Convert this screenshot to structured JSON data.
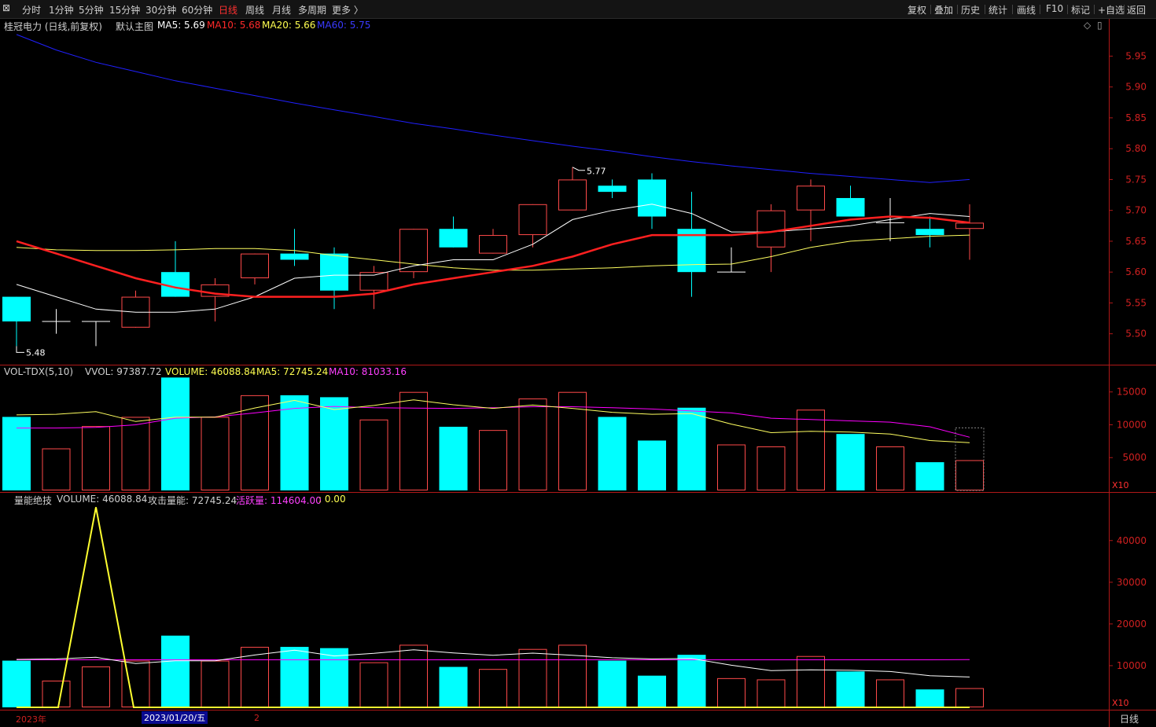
{
  "toolbar": {
    "left": [
      "分时",
      "1分钟",
      "5分钟",
      "15分钟",
      "30分钟",
      "60分钟",
      "日线",
      "周线",
      "月线",
      "多周期",
      "更多 〉"
    ],
    "active": "日线",
    "right": [
      "复权",
      "叠加",
      "历史",
      "统计",
      "画线",
      "F10",
      "标记",
      "+自选",
      "返回"
    ]
  },
  "main_legend": {
    "stock": "桂冠电力 (日线,前复权)",
    "template": "默认主图",
    "ma5": "MA5: 5.69",
    "ma10": "MA10: 5.68",
    "ma20": "MA20: 5.66",
    "ma60": "MA60: 5.75"
  },
  "vol_legend": {
    "name": "VOL-TDX(5,10)",
    "vvol": "VVOL: 97387.72",
    "volume": "VOLUME: 46088.84",
    "ma5": "MA5: 72745.24",
    "ma10": "MA10: 81033.16"
  },
  "energy_legend": {
    "name": "量能绝技",
    "volume": "VOLUME: 46088.84",
    "attack": "攻击量能: 72745.24",
    "active": "活跃量: 114604.00",
    "tail": ": 0.00"
  },
  "x10_label": "X10",
  "date_axis": {
    "year": "2023年",
    "cursor_date": "2023/01/20/五",
    "marker": "2"
  },
  "period_label": "日线",
  "colors": {
    "up": "#ff4a4a",
    "down": "#00ffff",
    "ma5": "#ffffff",
    "ma10": "#ff2020",
    "ma20": "#ffff60",
    "ma60": "#2020ff",
    "vol_ma10": "#ff00ff"
  },
  "chart_data": [
    {
      "type": "candlestick",
      "price_axis": {
        "ticks": [
          5.5,
          5.55,
          5.6,
          5.65,
          5.7,
          5.75,
          5.8,
          5.85,
          5.9,
          5.95
        ],
        "min": 5.455,
        "max": 5.99
      },
      "annotations": {
        "high": "5.77",
        "low": "5.48"
      },
      "candles": [
        {
          "o": 5.56,
          "h": 5.56,
          "l": 5.48,
          "c": 5.52
        },
        {
          "o": 5.52,
          "h": 5.54,
          "l": 5.5,
          "c": 5.52
        },
        {
          "o": 5.52,
          "h": 5.52,
          "l": 5.48,
          "c": 5.52
        },
        {
          "o": 5.51,
          "h": 5.57,
          "l": 5.51,
          "c": 5.56
        },
        {
          "o": 5.6,
          "h": 5.65,
          "l": 5.56,
          "c": 5.56
        },
        {
          "o": 5.56,
          "h": 5.59,
          "l": 5.52,
          "c": 5.58
        },
        {
          "o": 5.59,
          "h": 5.63,
          "l": 5.58,
          "c": 5.63
        },
        {
          "o": 5.63,
          "h": 5.67,
          "l": 5.61,
          "c": 5.62
        },
        {
          "o": 5.63,
          "h": 5.64,
          "l": 5.54,
          "c": 5.57
        },
        {
          "o": 5.57,
          "h": 5.61,
          "l": 5.54,
          "c": 5.6
        },
        {
          "o": 5.6,
          "h": 5.67,
          "l": 5.59,
          "c": 5.67
        },
        {
          "o": 5.67,
          "h": 5.69,
          "l": 5.64,
          "c": 5.64
        },
        {
          "o": 5.63,
          "h": 5.67,
          "l": 5.63,
          "c": 5.66
        },
        {
          "o": 5.66,
          "h": 5.71,
          "l": 5.64,
          "c": 5.71
        },
        {
          "o": 5.7,
          "h": 5.77,
          "l": 5.7,
          "c": 5.75
        },
        {
          "o": 5.74,
          "h": 5.75,
          "l": 5.72,
          "c": 5.73
        },
        {
          "o": 5.75,
          "h": 5.76,
          "l": 5.67,
          "c": 5.69
        },
        {
          "o": 5.67,
          "h": 5.73,
          "l": 5.56,
          "c": 5.6
        },
        {
          "o": 5.6,
          "h": 5.64,
          "l": 5.6,
          "c": 5.6
        },
        {
          "o": 5.64,
          "h": 5.71,
          "l": 5.6,
          "c": 5.7
        },
        {
          "o": 5.7,
          "h": 5.75,
          "l": 5.65,
          "c": 5.74
        },
        {
          "o": 5.72,
          "h": 5.74,
          "l": 5.69,
          "c": 5.69
        },
        {
          "o": 5.68,
          "h": 5.72,
          "l": 5.65,
          "c": 5.68
        },
        {
          "o": 5.67,
          "h": 5.69,
          "l": 5.64,
          "c": 5.66
        },
        {
          "o": 5.67,
          "h": 5.71,
          "l": 5.62,
          "c": 5.68
        }
      ],
      "ma5": [
        5.58,
        5.56,
        5.54,
        5.535,
        5.535,
        5.54,
        5.56,
        5.59,
        5.595,
        5.595,
        5.61,
        5.62,
        5.62,
        5.645,
        5.685,
        5.7,
        5.71,
        5.695,
        5.665,
        5.665,
        5.67,
        5.675,
        5.685,
        5.695,
        5.69
      ],
      "ma10": [
        5.65,
        5.63,
        5.61,
        5.59,
        5.575,
        5.565,
        5.56,
        5.56,
        5.56,
        5.565,
        5.58,
        5.59,
        5.6,
        5.61,
        5.625,
        5.645,
        5.66,
        5.66,
        5.66,
        5.665,
        5.675,
        5.685,
        5.69,
        5.688,
        5.68
      ],
      "ma20": [
        5.64,
        5.636,
        5.635,
        5.635,
        5.636,
        5.638,
        5.638,
        5.635,
        5.627,
        5.62,
        5.613,
        5.607,
        5.603,
        5.603,
        5.605,
        5.607,
        5.61,
        5.612,
        5.613,
        5.625,
        5.64,
        5.65,
        5.654,
        5.658,
        5.66
      ],
      "ma60": [
        5.985,
        5.96,
        5.94,
        5.925,
        5.91,
        5.898,
        5.886,
        5.874,
        5.863,
        5.852,
        5.841,
        5.832,
        5.822,
        5.813,
        5.804,
        5.796,
        5.787,
        5.779,
        5.772,
        5.766,
        5.76,
        5.755,
        5.75,
        5.745,
        5.75
      ]
    },
    {
      "type": "bar",
      "title": "VOL-TDX(5,10)",
      "axis": {
        "ticks": [
          5000,
          10000,
          15000
        ],
        "max": 17000,
        "multiplier": "X10"
      },
      "volume": [
        11200,
        6400,
        9800,
        11200,
        17200,
        11200,
        14500,
        14500,
        14200,
        10800,
        15000,
        9700,
        9200,
        14000,
        15000,
        11200,
        7600,
        12600,
        7000,
        6700,
        12300,
        8600,
        6700,
        4300,
        4610
      ],
      "ma5": [
        11500,
        11600,
        12000,
        10500,
        11160,
        11160,
        12560,
        13720,
        12320,
        12940,
        13800,
        13050,
        12500,
        13000,
        12500,
        11900,
        11600,
        11700,
        10100,
        8800,
        9000,
        8900,
        8600,
        7600,
        7270
      ],
      "ma10": [
        9500,
        9500,
        9600,
        10000,
        11000,
        11200,
        11800,
        12500,
        12800,
        12600,
        12550,
        12500,
        12600,
        12750,
        12750,
        12600,
        12400,
        12100,
        11800,
        11000,
        10800,
        10600,
        10400,
        9700,
        8100
      ]
    },
    {
      "type": "bar",
      "title": "量能绝技",
      "axis": {
        "ticks": [
          10000,
          20000,
          30000,
          40000
        ],
        "max": 49000,
        "multiplier": "X10"
      },
      "volume": [
        11200,
        6400,
        9800,
        11200,
        17200,
        11200,
        14500,
        14500,
        14200,
        10800,
        15000,
        9700,
        9200,
        14000,
        15000,
        11200,
        7600,
        12600,
        7000,
        6700,
        12300,
        8600,
        6700,
        4300,
        4610
      ],
      "attack": [
        11500,
        11600,
        12000,
        10500,
        11160,
        11160,
        12560,
        13720,
        12320,
        12940,
        13800,
        13050,
        12500,
        13000,
        12500,
        11900,
        11600,
        11700,
        10100,
        8800,
        9000,
        8900,
        8600,
        7600,
        7270
      ],
      "active_line": [
        11400,
        11400,
        11400,
        11400,
        11400,
        11400,
        11400,
        11400,
        11400,
        11400,
        11400,
        11400,
        11400,
        11400,
        11400,
        11400,
        11400,
        11400,
        11400,
        11400,
        11400,
        11400,
        11400,
        11400,
        11460
      ],
      "signal": [
        0,
        0,
        48000,
        0,
        0,
        0,
        0,
        0,
        0,
        0,
        0,
        0,
        0,
        0,
        0,
        0,
        0,
        0,
        0,
        0,
        0,
        0,
        0,
        0,
        0
      ]
    }
  ]
}
